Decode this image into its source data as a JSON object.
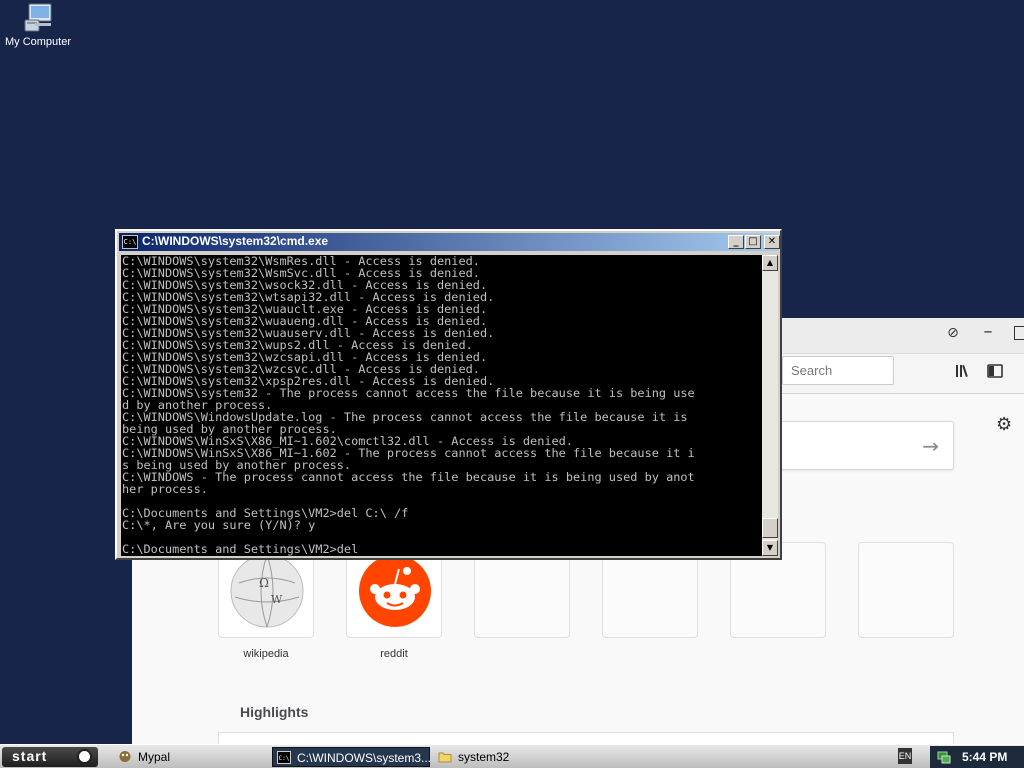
{
  "desktop": {
    "icons": [
      {
        "label": "My Computer"
      }
    ]
  },
  "browser": {
    "search_placeholder": "Search",
    "top_sites": [
      {
        "label": "wikipedia"
      },
      {
        "label": "reddit"
      },
      {
        "label": ""
      },
      {
        "label": ""
      },
      {
        "label": ""
      },
      {
        "label": ""
      }
    ],
    "highlights_heading": "Highlights"
  },
  "cmd": {
    "title": "C:\\WINDOWS\\system32\\cmd.exe",
    "output": "C:\\WINDOWS\\system32\\WsmRes.dll - Access is denied.\nC:\\WINDOWS\\system32\\WsmSvc.dll - Access is denied.\nC:\\WINDOWS\\system32\\wsock32.dll - Access is denied.\nC:\\WINDOWS\\system32\\wtsapi32.dll - Access is denied.\nC:\\WINDOWS\\system32\\wuauclt.exe - Access is denied.\nC:\\WINDOWS\\system32\\wuaueng.dll - Access is denied.\nC:\\WINDOWS\\system32\\wuauserv.dll - Access is denied.\nC:\\WINDOWS\\system32\\wups2.dll - Access is denied.\nC:\\WINDOWS\\system32\\wzcsapi.dll - Access is denied.\nC:\\WINDOWS\\system32\\wzcsvc.dll - Access is denied.\nC:\\WINDOWS\\system32\\xpsp2res.dll - Access is denied.\nC:\\WINDOWS\\system32 - The process cannot access the file because it is being use\nd by another process.\nC:\\WINDOWS\\WindowsUpdate.log - The process cannot access the file because it is\nbeing used by another process.\nC:\\WINDOWS\\WinSxS\\X86_MI~1.602\\comctl32.dll - Access is denied.\nC:\\WINDOWS\\WinSxS\\X86_MI~1.602 - The process cannot access the file because it i\ns being used by another process.\nC:\\WINDOWS - The process cannot access the file because it is being used by anot\nher process.\n\nC:\\Documents and Settings\\VM2>del C:\\ /f\nC:\\*, Are you sure (Y/N)? y\n\nC:\\Documents and Settings\\VM2>del"
  },
  "taskbar": {
    "start_label": "start",
    "tasks": [
      {
        "label": "Mypal"
      },
      {
        "label": "C:\\WINDOWS\\system3..."
      },
      {
        "label": "system32"
      }
    ],
    "language": "EN",
    "clock": "5:44 PM"
  }
}
